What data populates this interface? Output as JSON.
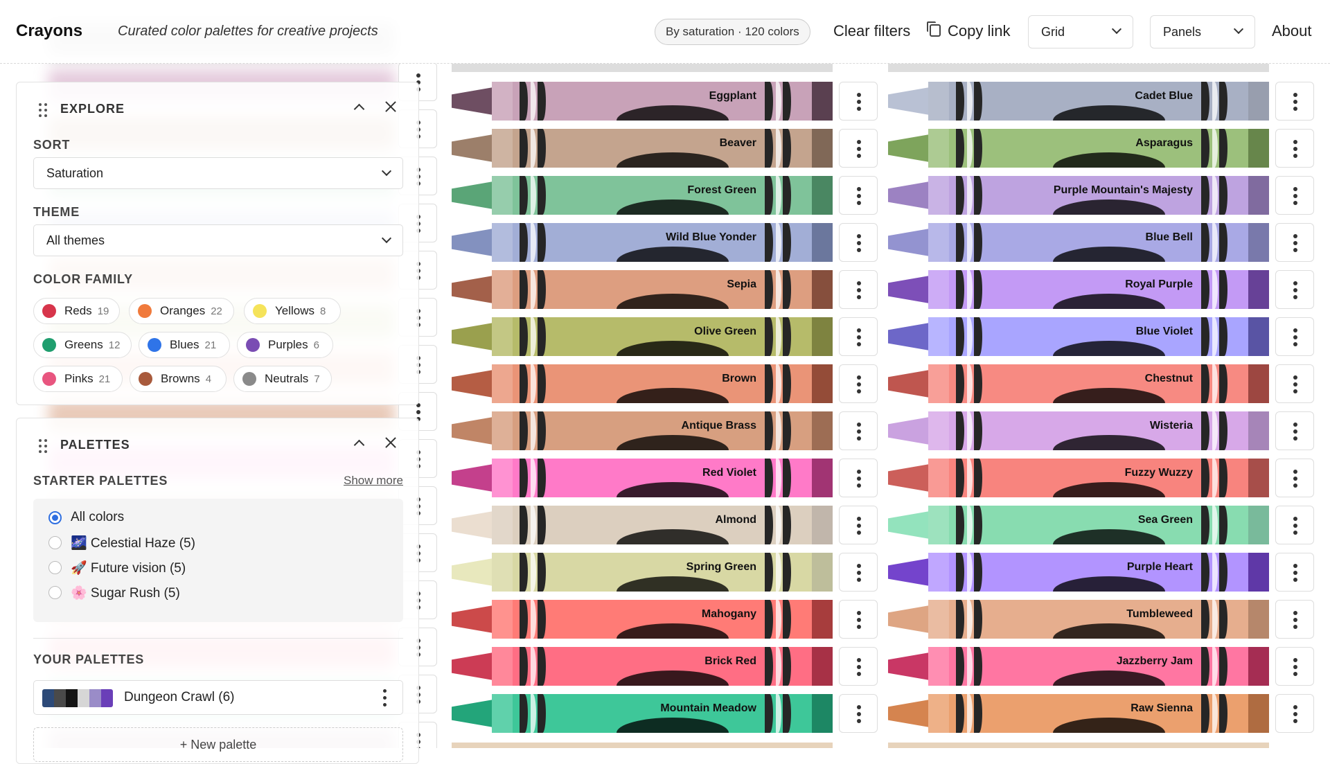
{
  "header": {
    "brand": "Crayons",
    "tagline": "Curated color palettes for creative projects",
    "status_pill": "By saturation · 120 colors",
    "clear_filters": "Clear filters",
    "copy_link": "Copy link",
    "view_select": "Grid",
    "layout_select": "Panels",
    "about": "About"
  },
  "explore": {
    "title": "EXPLORE",
    "sort_label": "SORT",
    "sort_value": "Saturation",
    "theme_label": "THEME",
    "theme_value": "All themes",
    "family_label": "COLOR FAMILY",
    "families": [
      {
        "name": "Reds",
        "count": "19",
        "color": "#d7354b"
      },
      {
        "name": "Oranges",
        "count": "22",
        "color": "#f07a3c"
      },
      {
        "name": "Yellows",
        "count": "8",
        "color": "#f5e35a"
      },
      {
        "name": "Greens",
        "count": "12",
        "color": "#1f9e6e"
      },
      {
        "name": "Blues",
        "count": "21",
        "color": "#2f74e8"
      },
      {
        "name": "Purples",
        "count": "6",
        "color": "#7a4db3"
      },
      {
        "name": "Pinks",
        "count": "21",
        "color": "#e8557f"
      },
      {
        "name": "Browns",
        "count": "4",
        "color": "#a85a3c"
      },
      {
        "name": "Neutrals",
        "count": "7",
        "color": "#8a8a8a"
      }
    ]
  },
  "palettes": {
    "title": "PALETTES",
    "starter_label": "STARTER PALETTES",
    "show_more": "Show more",
    "starter": [
      {
        "label": "All colors",
        "selected": true
      },
      {
        "label": "🌌 Celestial Haze (5)",
        "selected": false
      },
      {
        "label": "🚀 Future vision (5)",
        "selected": false
      },
      {
        "label": "🌸 Sugar Rush (5)",
        "selected": false
      }
    ],
    "yours_label": "YOUR PALETTES",
    "yours": [
      {
        "name": "Dungeon Crawl (6)",
        "swatches": [
          "#2d4a78",
          "#4a4a4a",
          "#141414",
          "#d6d6d6",
          "#9a8cc8",
          "#6a3fb8"
        ]
      }
    ],
    "new_palette": "+ New palette"
  },
  "crayons_col1": [
    {
      "name": "Eggplant",
      "color": "#c8a2b8",
      "tip": "#6e4e62"
    },
    {
      "name": "Beaver",
      "color": "#c4a48e",
      "tip": "#9c7f6a"
    },
    {
      "name": "Forest Green",
      "color": "#7fc39a",
      "tip": "#5aa577"
    },
    {
      "name": "Wild Blue Yonder",
      "color": "#a2aed6",
      "tip": "#8391bf"
    },
    {
      "name": "Sepia",
      "color": "#dd9e80",
      "tip": "#a3604a"
    },
    {
      "name": "Olive Green",
      "color": "#b6bb6a",
      "tip": "#9aa04e"
    },
    {
      "name": "Brown",
      "color": "#ea9477",
      "tip": "#b55d44"
    },
    {
      "name": "Antique Brass",
      "color": "#d79f80",
      "tip": "#c08566"
    },
    {
      "name": "Red Violet",
      "color": "#ff7ac8",
      "tip": "#c4408c"
    },
    {
      "name": "Almond",
      "color": "#dccfbf",
      "tip": "#ebded0"
    },
    {
      "name": "Spring Green",
      "color": "#d8d8a4",
      "tip": "#e8e8bd"
    },
    {
      "name": "Mahogany",
      "color": "#ff7b76",
      "tip": "#cc4a4a"
    },
    {
      "name": "Brick Red",
      "color": "#ff6e84",
      "tip": "#cc3c55"
    },
    {
      "name": "Mountain Meadow",
      "color": "#3ec799",
      "tip": "#23a57a"
    }
  ],
  "crayons_col2": [
    {
      "name": "Cadet Blue",
      "color": "#a8b0c4",
      "tip": "#b9c1d4"
    },
    {
      "name": "Asparagus",
      "color": "#9cc07c",
      "tip": "#7ea45c"
    },
    {
      "name": "Purple Mountain's Majesty",
      "color": "#bea3e0",
      "tip": "#9c82c2"
    },
    {
      "name": "Blue Bell",
      "color": "#a9a9e5",
      "tip": "#9393d0"
    },
    {
      "name": "Royal Purple",
      "color": "#c39af5",
      "tip": "#7d4fb8"
    },
    {
      "name": "Blue Violet",
      "color": "#a9a5ff",
      "tip": "#6d67c8"
    },
    {
      "name": "Chestnut",
      "color": "#f78a82",
      "tip": "#bf564f"
    },
    {
      "name": "Wisteria",
      "color": "#d7a8e8",
      "tip": "#caa2e0"
    },
    {
      "name": "Fuzzy Wuzzy",
      "color": "#f8847e",
      "tip": "#cc5f5a"
    },
    {
      "name": "Sea Green",
      "color": "#88dcb0",
      "tip": "#93e3bd"
    },
    {
      "name": "Purple Heart",
      "color": "#b294ff",
      "tip": "#7444cc"
    },
    {
      "name": "Tumbleweed",
      "color": "#e6ae8e",
      "tip": "#dea583"
    },
    {
      "name": "Jazzberry Jam",
      "color": "#ff76a2",
      "tip": "#c93765"
    },
    {
      "name": "Raw Sienna",
      "color": "#eba06e",
      "tip": "#d5844f"
    }
  ]
}
